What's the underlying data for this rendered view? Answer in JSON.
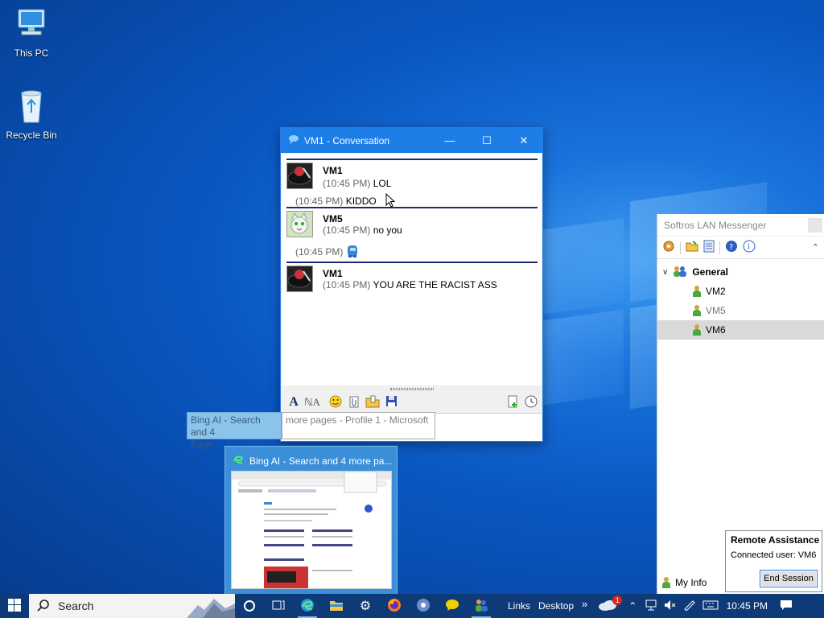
{
  "desktop": {
    "icons": [
      {
        "label": "This PC",
        "icon": "this-pc-icon"
      },
      {
        "label": "Recycle Bin",
        "icon": "recycle-bin-icon"
      }
    ]
  },
  "conversation": {
    "title": "VM1 - Conversation",
    "messages": [
      {
        "sender": "VM1",
        "lines": [
          {
            "time": "(10:45 PM)",
            "text": "LOL"
          },
          {
            "time": "(10:45 PM)",
            "text": "KIDDO"
          }
        ]
      },
      {
        "sender": "VM5",
        "lines": [
          {
            "time": "(10:45 PM)",
            "text": "no you"
          },
          {
            "time": "(10:45 PM)",
            "text": "",
            "emoji": "game-emoticon"
          }
        ]
      },
      {
        "sender": "VM1",
        "lines": [
          {
            "time": "(10:45 PM)",
            "text": "YOU ARE THE RACIST ASS"
          }
        ]
      }
    ]
  },
  "tooltip": {
    "left": "Bing AI - Search and 4 more pages - Profile 1 - Microsoft Edge",
    "left_line1": "Bing AI - Search and 4",
    "left_line2": "Edge",
    "right": "more pages - Profile 1 - Microsoft"
  },
  "thumbnail": {
    "title": "Bing AI - Search and 4 more pa..."
  },
  "messenger": {
    "title": "Softros LAN Messenger",
    "group": "General",
    "users": [
      "VM2",
      "VM5",
      "VM6"
    ],
    "selected_user": "VM6",
    "my_info": "My Info"
  },
  "remote_assistance": {
    "title": "Remote Assistance",
    "connected_label": "Connected user:",
    "connected_user": "VM6",
    "end_button": "End Session"
  },
  "taskbar": {
    "search_placeholder": "Search",
    "links_label": "Links",
    "desktop_label": "Desktop",
    "weather_badge": "1",
    "clock": "10:45 PM"
  }
}
